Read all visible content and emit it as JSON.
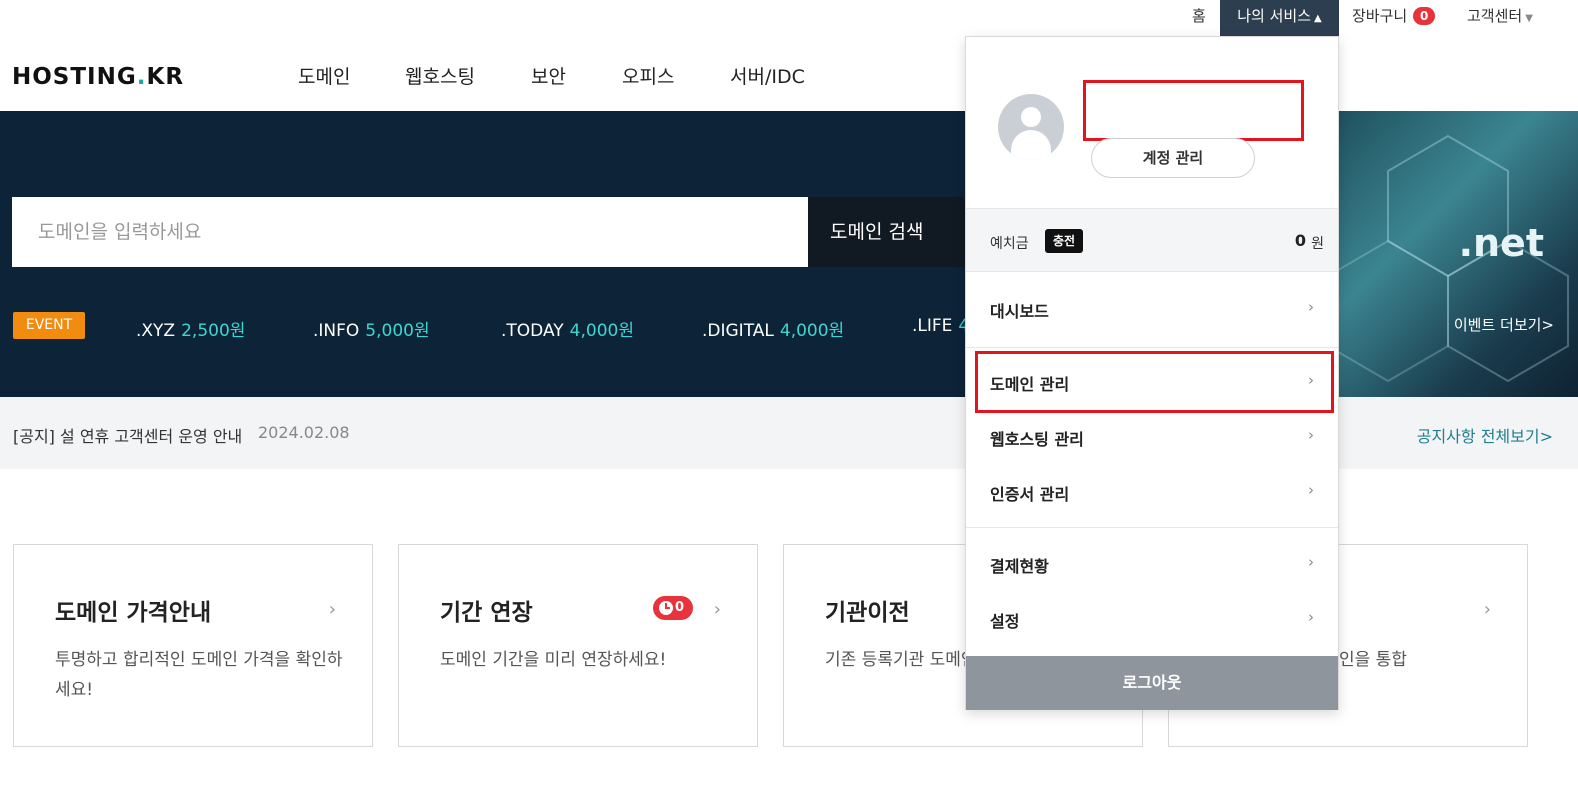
{
  "topbar": {
    "home": "홈",
    "my_service": "나의 서비스",
    "cart": "장바구니",
    "cart_count": "0",
    "customer_center": "고객센터"
  },
  "logo": {
    "prefix": "HOSTING",
    "dot": ".",
    "suffix": "KR"
  },
  "nav": [
    "도메인",
    "웹호스팅",
    "보안",
    "오피스",
    "서버/IDC"
  ],
  "search": {
    "placeholder": "도메인을 입력하세요",
    "button": "도메인 검색"
  },
  "event": {
    "badge": "EVENT",
    "tlds": [
      {
        "name": ".XYZ",
        "price": "2,500원"
      },
      {
        "name": ".INFO",
        "price": "5,000원"
      },
      {
        "name": ".TODAY",
        "price": "4,000원"
      },
      {
        "name": ".DIGITAL",
        "price": "4,000원"
      },
      {
        "name": ".LIFE",
        "price": "4"
      }
    ],
    "art_text": ".net",
    "more": "이벤트 더보기>"
  },
  "notice": {
    "text": "[공지] 설 연휴 고객센터 운영 안내",
    "date": "2024.02.08",
    "all": "공지사항 전체보기>"
  },
  "cards": [
    {
      "title": "도메인 가격안내",
      "desc": "투명하고 합리적인 도메인 가격을 확인하세요!"
    },
    {
      "title": "기간 연장",
      "desc": "도메인 기간을 미리 연장하세요!",
      "badge": "0"
    },
    {
      "title": "기관이전",
      "desc": "기존 등록기관 도메인을 옮기세요!"
    },
    {
      "title": "",
      "desc": "인을 통합"
    }
  ],
  "dropdown": {
    "account_manage": "계정 관리",
    "deposit_label": "예치금",
    "charge": "충전",
    "deposit_amount": "0",
    "deposit_unit": "원",
    "items": [
      "대시보드",
      "도메인 관리",
      "웹호스팅 관리",
      "인증서 관리",
      "결제현황",
      "설정"
    ],
    "logout": "로그아웃"
  },
  "colors": {
    "hero_bg": "#0c2338",
    "accent_teal": "#3ed6d2",
    "event_orange": "#f28c11",
    "highlight_red": "#e2141d",
    "my_service_bg": "#2c3e50"
  }
}
